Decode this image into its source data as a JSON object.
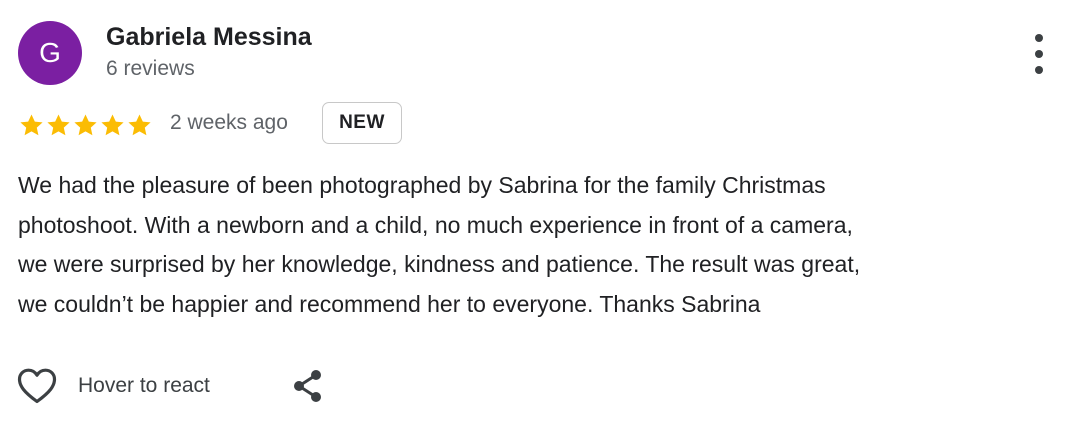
{
  "reviewer": {
    "avatar_letter": "G",
    "avatar_color": "#7b1fa2",
    "name": "Gabriela Messina",
    "review_count": "6 reviews"
  },
  "rating": {
    "stars": 5,
    "max_stars": 5,
    "star_color": "#fbbc04"
  },
  "meta": {
    "time_ago": "2 weeks ago",
    "badge": "NEW"
  },
  "review": {
    "lines": [
      "We had the pleasure of been photographed by Sabrina for the family Christmas",
      "photoshoot. With a newborn and a child, no much experience in front of a camera,",
      "we were surprised by her knowledge, kindness and patience. The result was great,",
      "we couldn’t be happier and recommend her to everyone. Thanks Sabrina"
    ]
  },
  "actions": {
    "react_label": "Hover to react",
    "react_icon": "heart-outline-icon",
    "share_icon": "share-icon",
    "more_icon": "more-vertical-icon"
  }
}
